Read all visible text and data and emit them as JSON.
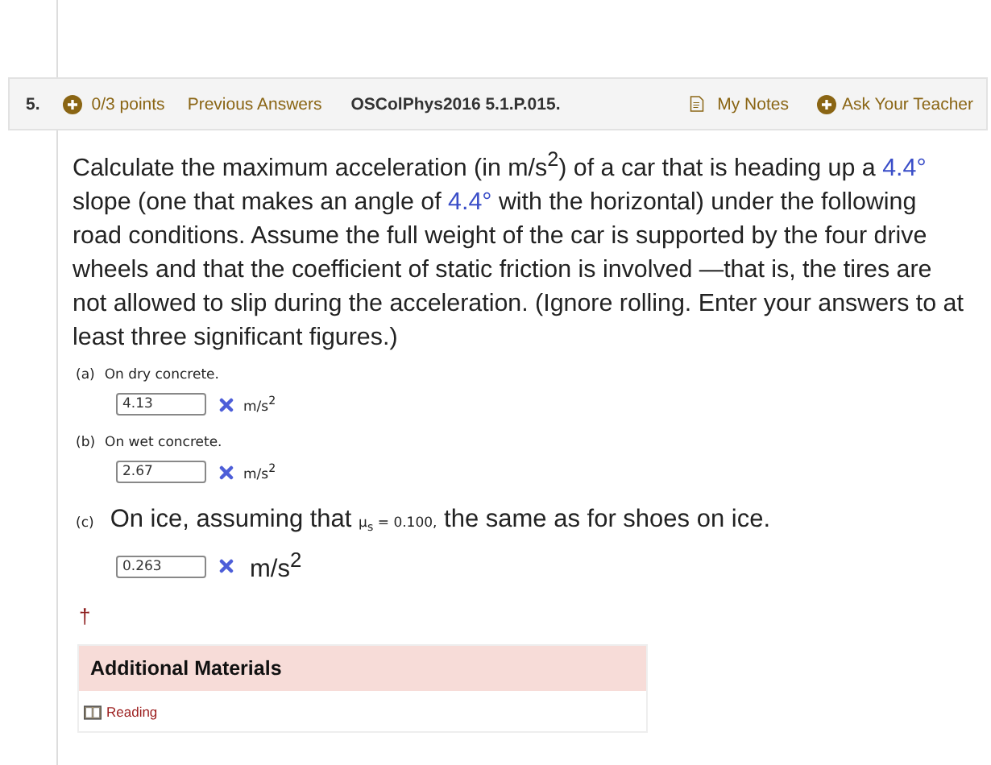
{
  "question": {
    "number": "5.",
    "points": "0/3 points",
    "previous_answers": "Previous Answers",
    "code": "OSColPhys2016 5.1.P.015.",
    "my_notes": "My Notes",
    "ask_teacher": "Ask Your Teacher"
  },
  "prompt": [
    {
      "kind": "plain",
      "text": "Calculate the maximum acceleration (in m/s$^{2}$) of a car that is heading up a"
    },
    {
      "kind": "value",
      "text": "4.4°"
    },
    {
      "kind": "plain",
      "text": "slope (one that makes an angle of"
    },
    {
      "kind": "value",
      "text": "4.4°"
    },
    {
      "kind": "plain",
      "text": "with the horizontal) under the following road conditions. Assume the full weight of the car is supported by the four drive wheels and that the coefficient of static friction is involved —that is, the tires are not allowed to slip during the acceleration. (Ignore rolling. Enter your answers to at least three significant figures.)"
    }
  ],
  "parts": [
    {
      "label": "(a)",
      "kind": "small",
      "prompt": [
        {
          "kind": "plain",
          "text": "On dry concrete."
        }
      ],
      "answer": "4.13",
      "correct": false,
      "unit": "m/s$^{2}$"
    },
    {
      "label": "(b)",
      "kind": "small",
      "prompt": [
        {
          "kind": "plain",
          "text": "On wet concrete."
        }
      ],
      "answer": "2.67",
      "correct": false,
      "unit": "m/s$^{2}$"
    },
    {
      "label": "(c)",
      "kind": "large",
      "prompt": [
        {
          "kind": "plain",
          "text": "On ice, assuming that"
        },
        {
          "kind": "formula",
          "text": "μ$_{s}$ = 0.100,"
        },
        {
          "kind": "plain",
          "text": "the same as for shoes on ice."
        }
      ],
      "answer": "0.263",
      "correct": false,
      "unit": "m/s$^{2}$"
    }
  ],
  "dagger": "†",
  "additional_materials": {
    "title": "Additional Materials",
    "links": [
      "Reading"
    ]
  }
}
